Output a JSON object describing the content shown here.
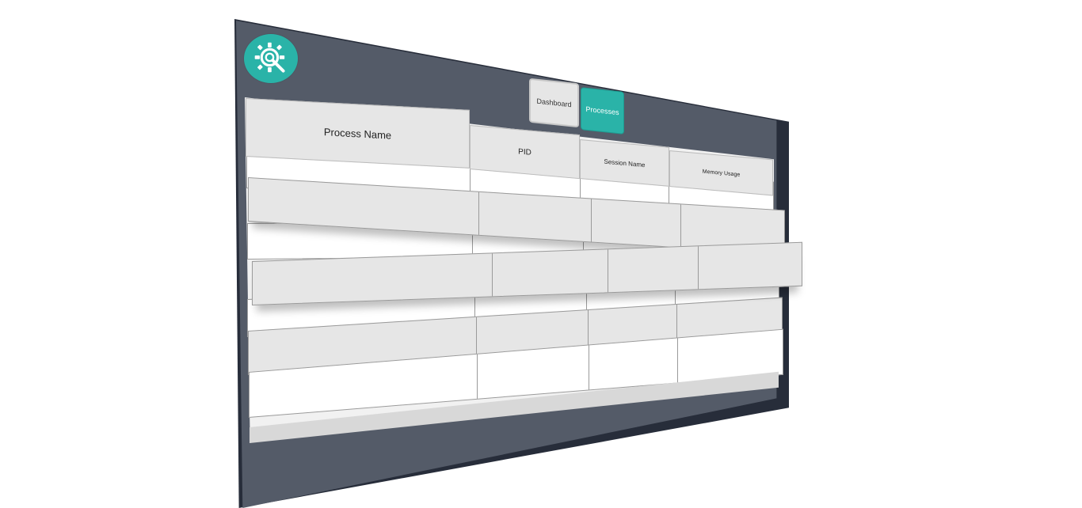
{
  "app": {
    "logo_icon": "gear-wrench-icon",
    "accent_color": "#2ab3a8",
    "panel_color": "#545b68"
  },
  "tabs": [
    {
      "label": "Dashboard",
      "active": false
    },
    {
      "label": "Processes",
      "active": true
    }
  ],
  "table": {
    "columns": [
      "Process Name",
      "PID",
      "Session Name",
      "Memory Usage"
    ],
    "rows": [
      [
        "",
        "",
        "",
        ""
      ],
      [
        "",
        "",
        "",
        ""
      ],
      [
        "",
        "",
        "",
        ""
      ],
      [
        "",
        "",
        "",
        ""
      ],
      [
        "",
        "",
        "",
        ""
      ],
      [
        "",
        "",
        "",
        ""
      ],
      [
        "",
        "",
        "",
        ""
      ]
    ]
  }
}
